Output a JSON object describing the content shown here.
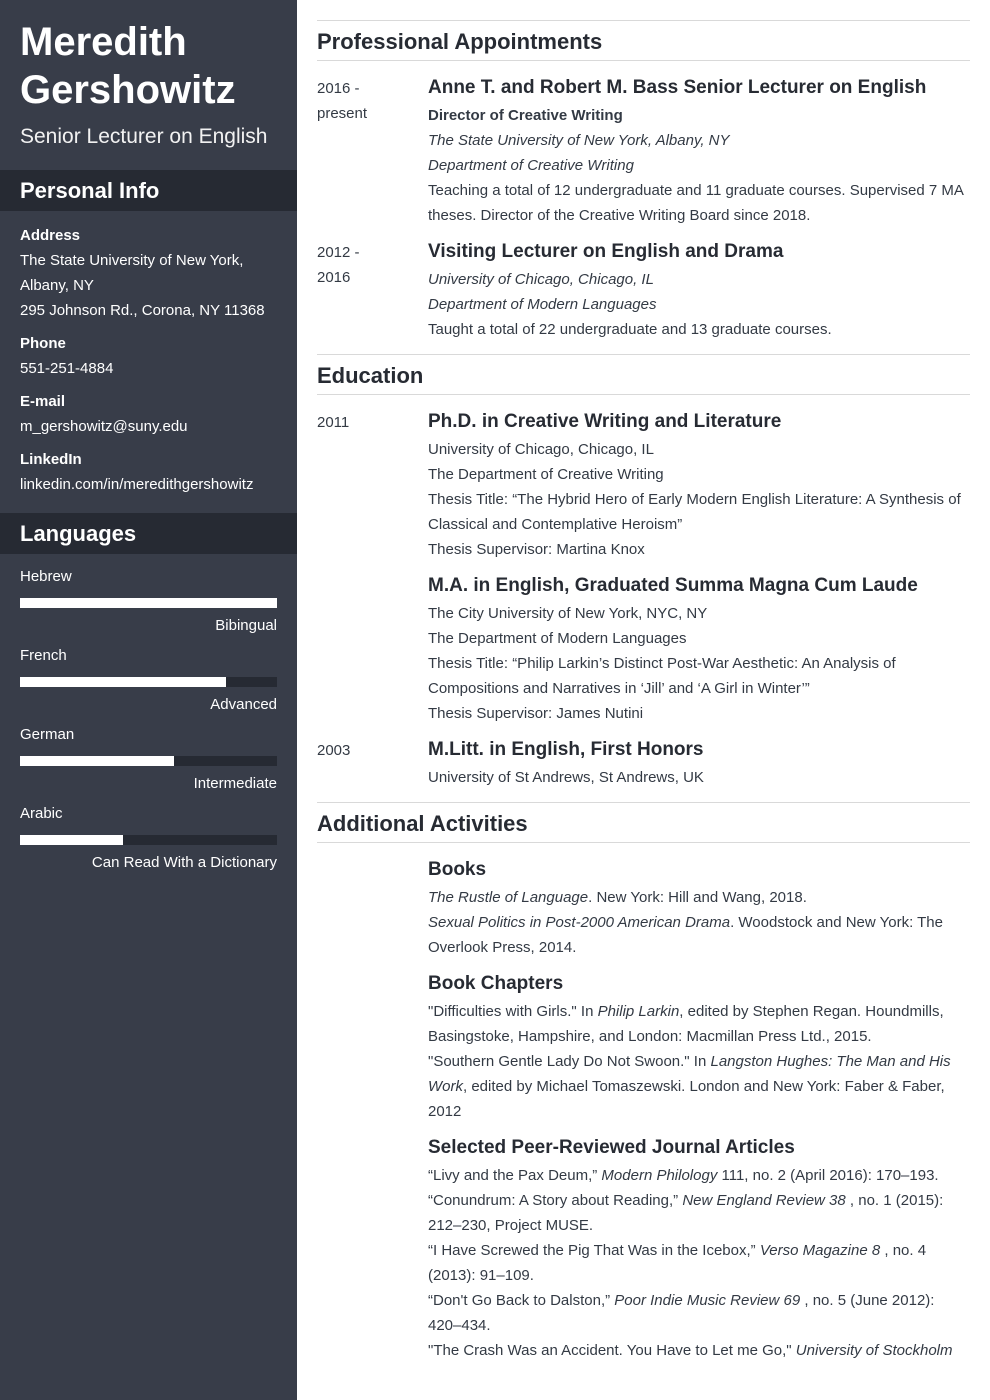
{
  "profile": {
    "first_name": "Meredith",
    "last_name": "Gershowitz",
    "title": "Senior Lecturer on English"
  },
  "personal_info": {
    "heading": "Personal Info",
    "address_label": "Address",
    "address_lines": [
      "The State University of New York,",
      "Albany, NY",
      "295 Johnson Rd., Corona, NY 11368"
    ],
    "phone_label": "Phone",
    "phone": "551-251-4884",
    "email_label": "E-mail",
    "email": "m_gershowitz@suny.edu",
    "linkedin_label": "LinkedIn",
    "linkedin": "linkedin.com/in/meredithgershowitz"
  },
  "languages": {
    "heading": "Languages",
    "items": [
      {
        "name": "Hebrew",
        "level": "Bibingual",
        "proficiency": 1.0
      },
      {
        "name": "French",
        "level": "Advanced",
        "proficiency": 0.8
      },
      {
        "name": "German",
        "level": "Intermediate",
        "proficiency": 0.6
      },
      {
        "name": "Arabic",
        "level": "Can Read With a Dictionary",
        "proficiency": 0.4
      }
    ]
  },
  "appointments": {
    "heading": "Professional Appointments",
    "items": [
      {
        "date_start": "2016 -",
        "date_end": "present",
        "title": "Anne T. and Robert M. Bass Senior Lecturer on English",
        "subtitle": "Director of Creative Writing",
        "institution": "The State University of New York, Albany, NY",
        "department": "Department of Creative Writing",
        "description": "Teaching a total of 12 undergraduate and 11 graduate courses. Supervised 7 MA theses. Director of the Creative Writing Board since 2018."
      },
      {
        "date_start": "2012 -",
        "date_end": "2016",
        "title": "Visiting Lecturer on English and Drama",
        "institution": "University of Chicago, Chicago, IL",
        "department": "Department of Modern Languages",
        "description": "Taught a total of 22 undergraduate and 13 graduate courses."
      }
    ]
  },
  "education": {
    "heading": "Education",
    "items": [
      {
        "date": "2011",
        "title": "Ph.D. in Creative Writing and Literature",
        "lines": [
          "University of Chicago, Chicago, IL",
          "The Department of Creative Writing",
          "Thesis Title: “The Hybrid Hero of Early Modern English Literature: A Synthesis of Classical and Contemplative Heroism”",
          "Thesis Supervisor: Martina Knox"
        ]
      },
      {
        "date": "",
        "title": "M.A. in English, Graduated Summa Magna Cum Laude",
        "lines": [
          "The City University of New York, NYC, NY",
          "The Department of Modern Languages",
          "Thesis Title: “Philip Larkin’s Distinct Post-War Aesthetic: An Analysis of Compositions and Narratives in ‘Jill’ and ‘A Girl in Winter’”",
          "Thesis Supervisor: James Nutini"
        ]
      },
      {
        "date": "2003",
        "title": "M.Litt. in English, First Honors",
        "lines": [
          "University of St Andrews, St Andrews, UK"
        ]
      }
    ]
  },
  "activities": {
    "heading": "Additional Activities",
    "books": {
      "title": "Books",
      "items": [
        {
          "italic": "The Rustle of Language",
          "rest": ". New York: Hill and Wang, 2018."
        },
        {
          "italic": "Sexual Politics in Post-2000 American Drama",
          "rest": ". Woodstock and New York: The Overlook Press, 2014."
        }
      ]
    },
    "chapters": {
      "title": "Book Chapters",
      "items": [
        {
          "pre": "\"Difficulties with Girls.\" In ",
          "italic": "Philip Larkin",
          "rest": ", edited by Stephen Regan. Houndmills, Basingstoke, Hampshire, and London: Macmillan Press Ltd., 2015."
        },
        {
          "pre": "\"Southern Gentle Lady Do Not Swoon.\" In ",
          "italic": "Langston Hughes: The Man and His Work",
          "rest": ", edited by Michael Tomaszewski. London and New York: Faber & Faber, 2012"
        }
      ]
    },
    "articles": {
      "title": "Selected Peer-Reviewed Journal Articles",
      "items": [
        {
          "pre": "“Livy and the Pax Deum,” ",
          "italic": "Modern Philology",
          "rest": " 111, no. 2 (April 2016): 170–193."
        },
        {
          "pre": "“Conundrum: A Story about Reading,” ",
          "italic": "New England Review 38",
          "rest": " , no. 1 (2015): 212–230, Project MUSE."
        },
        {
          "pre": "“I Have Screwed the Pig That Was in the Icebox,” ",
          "italic": "Verso Magazine 8",
          "rest": " , no. 4 (2013): 91–109."
        },
        {
          "pre": "“Don't Go Back to Dalston,” ",
          "italic": "Poor Indie Music Review 69",
          "rest": " , no. 5 (June 2012): 420–434."
        },
        {
          "pre": "\"The Crash Was an Accident. You Have to Let me Go,\" ",
          "italic": "University of Stockholm",
          "rest": ""
        }
      ]
    }
  },
  "colors": {
    "sidebar_bg": "#383d49",
    "sidebar_header_bg": "#262a33",
    "text": "#333a44",
    "rule": "#d9d9d9"
  }
}
